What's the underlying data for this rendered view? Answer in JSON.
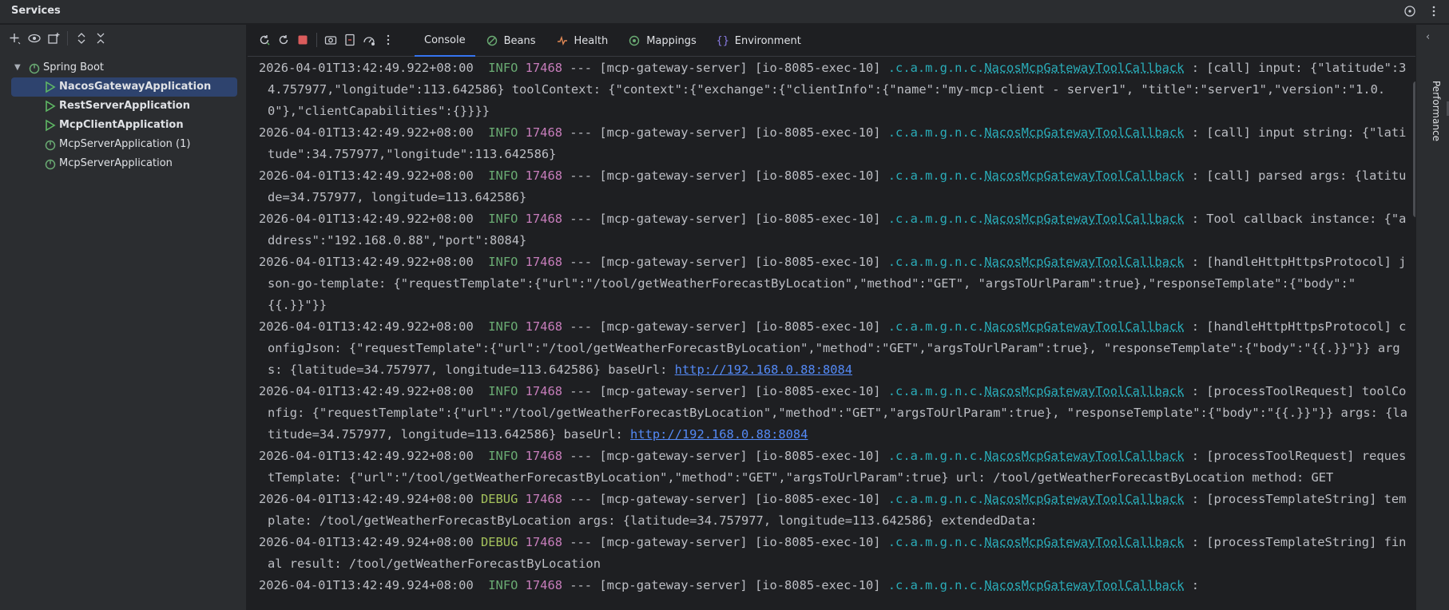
{
  "window": {
    "title": "Services"
  },
  "colors": {
    "accent": "#3574f0",
    "info": "#6aab73",
    "debug": "#a5c25c",
    "pid": "#c77dbb",
    "logger": "#2aacb8",
    "link": "#548af7",
    "selected_bg": "#2e436e"
  },
  "tree": {
    "root": {
      "label": "Spring Boot",
      "icon": "spring-boot-icon",
      "expanded": true
    },
    "items": [
      {
        "label": "NacosGatewayApplication",
        "icon": "run-icon",
        "running": true,
        "selected": true
      },
      {
        "label": "RestServerApplication",
        "icon": "run-icon",
        "running": true,
        "selected": false
      },
      {
        "label": "McpClientApplication",
        "icon": "run-icon",
        "running": true,
        "selected": false
      },
      {
        "label": "McpServerApplication (1)",
        "icon": "spring-boot-icon",
        "running": false,
        "selected": false
      },
      {
        "label": "McpServerApplication",
        "icon": "spring-boot-icon",
        "running": false,
        "selected": false
      }
    ]
  },
  "console_tabs": [
    {
      "label": "Console",
      "icon": "",
      "active": true
    },
    {
      "label": "Beans",
      "icon": "beans-icon",
      "active": false
    },
    {
      "label": "Health",
      "icon": "health-icon",
      "active": false
    },
    {
      "label": "Mappings",
      "icon": "mappings-icon",
      "active": false
    },
    {
      "label": "Environment",
      "icon": "environment-icon",
      "active": false
    }
  ],
  "right_panel": {
    "label": "Performance"
  },
  "log": {
    "entries": [
      {
        "ts": "2026-04-01T13:42:49.922+08:00",
        "level": "INFO",
        "pid": "17468",
        "sep": "---",
        "app": "[mcp-gateway-server]",
        "thread": "[io-8085-exec-10]",
        "pkg": ".c.a.m.g.n.c.",
        "cls": "NacosMcpGatewayToolCallback",
        "msg": " : [call] input: {\"latitude\":34.757977,\"longitude\":113.642586} toolContext: {\"context\":{\"exchange\":{\"clientInfo\":{\"name\":\"my-mcp-client - server1\", \"title\":\"server1\",\"version\":\"1.0.0\"},\"clientCapabilities\":{}}}}",
        "url": ""
      },
      {
        "ts": "2026-04-01T13:42:49.922+08:00",
        "level": "INFO",
        "pid": "17468",
        "sep": "---",
        "app": "[mcp-gateway-server]",
        "thread": "[io-8085-exec-10]",
        "pkg": ".c.a.m.g.n.c.",
        "cls": "NacosMcpGatewayToolCallback",
        "msg": " : [call] input string: {\"latitude\":34.757977,\"longitude\":113.642586}",
        "url": ""
      },
      {
        "ts": "2026-04-01T13:42:49.922+08:00",
        "level": "INFO",
        "pid": "17468",
        "sep": "---",
        "app": "[mcp-gateway-server]",
        "thread": "[io-8085-exec-10]",
        "pkg": ".c.a.m.g.n.c.",
        "cls": "NacosMcpGatewayToolCallback",
        "msg": " : [call] parsed args: {latitude=34.757977, longitude=113.642586}",
        "url": ""
      },
      {
        "ts": "2026-04-01T13:42:49.922+08:00",
        "level": "INFO",
        "pid": "17468",
        "sep": "---",
        "app": "[mcp-gateway-server]",
        "thread": "[io-8085-exec-10]",
        "pkg": ".c.a.m.g.n.c.",
        "cls": "NacosMcpGatewayToolCallback",
        "msg": " : Tool callback instance: {\"address\":\"192.168.0.88\",\"port\":8084}",
        "url": ""
      },
      {
        "ts": "2026-04-01T13:42:49.922+08:00",
        "level": "INFO",
        "pid": "17468",
        "sep": "---",
        "app": "[mcp-gateway-server]",
        "thread": "[io-8085-exec-10]",
        "pkg": ".c.a.m.g.n.c.",
        "cls": "NacosMcpGatewayToolCallback",
        "msg": " : [handleHttpHttpsProtocol] json-go-template: {\"requestTemplate\":{\"url\":\"/tool/getWeatherForecastByLocation\",\"method\":\"GET\", \"argsToUrlParam\":true},\"responseTemplate\":{\"body\":\"{{.}}\"}}",
        "url": ""
      },
      {
        "ts": "2026-04-01T13:42:49.922+08:00",
        "level": "INFO",
        "pid": "17468",
        "sep": "---",
        "app": "[mcp-gateway-server]",
        "thread": "[io-8085-exec-10]",
        "pkg": ".c.a.m.g.n.c.",
        "cls": "NacosMcpGatewayToolCallback",
        "msg": " : [handleHttpHttpsProtocol] configJson: {\"requestTemplate\":{\"url\":\"/tool/getWeatherForecastByLocation\",\"method\":\"GET\",\"argsToUrlParam\":true}, \"responseTemplate\":{\"body\":\"{{.}}\"}} args: {latitude=34.757977, longitude=113.642586} baseUrl: ",
        "url": "http://192.168.0.88:8084"
      },
      {
        "ts": "2026-04-01T13:42:49.922+08:00",
        "level": "INFO",
        "pid": "17468",
        "sep": "---",
        "app": "[mcp-gateway-server]",
        "thread": "[io-8085-exec-10]",
        "pkg": ".c.a.m.g.n.c.",
        "cls": "NacosMcpGatewayToolCallback",
        "msg": " : [processToolRequest] toolConfig: {\"requestTemplate\":{\"url\":\"/tool/getWeatherForecastByLocation\",\"method\":\"GET\",\"argsToUrlParam\":true}, \"responseTemplate\":{\"body\":\"{{.}}\"}} args: {latitude=34.757977, longitude=113.642586} baseUrl: ",
        "url": "http://192.168.0.88:8084"
      },
      {
        "ts": "2026-04-01T13:42:49.922+08:00",
        "level": "INFO",
        "pid": "17468",
        "sep": "---",
        "app": "[mcp-gateway-server]",
        "thread": "[io-8085-exec-10]",
        "pkg": ".c.a.m.g.n.c.",
        "cls": "NacosMcpGatewayToolCallback",
        "msg": " : [processToolRequest] requestTemplate: {\"url\":\"/tool/getWeatherForecastByLocation\",\"method\":\"GET\",\"argsToUrlParam\":true} url: /tool/getWeatherForecastByLocation method: GET",
        "url": ""
      },
      {
        "ts": "2026-04-01T13:42:49.924+08:00",
        "level": "DEBUG",
        "pid": "17468",
        "sep": "---",
        "app": "[mcp-gateway-server]",
        "thread": "[io-8085-exec-10]",
        "pkg": ".c.a.m.g.n.c.",
        "cls": "NacosMcpGatewayToolCallback",
        "msg": " : [processTemplateString] template: /tool/getWeatherForecastByLocation args: {latitude=34.757977, longitude=113.642586} extendedData:",
        "url": ""
      },
      {
        "ts": "2026-04-01T13:42:49.924+08:00",
        "level": "DEBUG",
        "pid": "17468",
        "sep": "---",
        "app": "[mcp-gateway-server]",
        "thread": "[io-8085-exec-10]",
        "pkg": ".c.a.m.g.n.c.",
        "cls": "NacosMcpGatewayToolCallback",
        "msg": " : [processTemplateString] final result: /tool/getWeatherForecastByLocation",
        "url": ""
      },
      {
        "ts": "2026-04-01T13:42:49.924+08:00",
        "level": "INFO",
        "pid": "17468",
        "sep": "---",
        "app": "[mcp-gateway-server]",
        "thread": "[io-8085-exec-10]",
        "pkg": ".c.a.m.g.n.c.",
        "cls": "NacosMcpGatewayToolCallback",
        "msg": " :",
        "url": ""
      }
    ]
  }
}
